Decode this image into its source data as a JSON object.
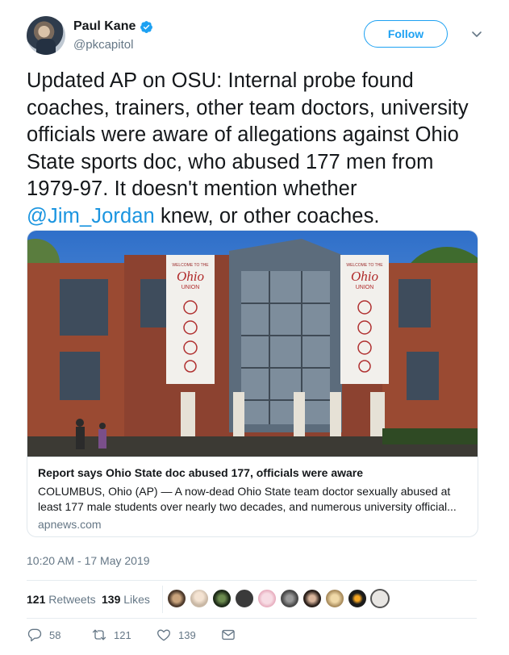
{
  "user": {
    "display_name": "Paul Kane",
    "handle": "@pkcapitol",
    "verified": true
  },
  "header": {
    "follow_label": "Follow"
  },
  "tweet": {
    "text_before": "Updated AP on OSU: Internal probe found coaches, trainers, other team doctors, university officials were aware of allegations against Ohio State sports doc, who abused 177 men from 1979-97. It doesn't mention whether ",
    "mention": "@Jim_Jordan",
    "text_after": " knew, or other coaches."
  },
  "card": {
    "title": "Report says Ohio State doc abused 177, officials were aware",
    "description": "COLUMBUS, Ohio (AP) — A now-dead Ohio State team doctor sexually abused at least 177 male students over nearly two decades, and numerous university official...",
    "domain": "apnews.com",
    "image": {
      "banner_top_text": "WELCOME TO THE",
      "banner_title": "Ohio",
      "banner_subtitle": "UNION"
    }
  },
  "timestamp": "10:20 AM - 17 May 2019",
  "stats": {
    "retweets_count": "121",
    "retweets_label": "Retweets",
    "likes_count": "139",
    "likes_label": "Likes",
    "liker_avatar_count": 9
  },
  "actions": {
    "reply_count": "58",
    "retweet_count": "121",
    "like_count": "139"
  },
  "colors": {
    "accent": "#1da1f2",
    "mention": "#1b95e0",
    "muted": "#657786",
    "text": "#14171a"
  },
  "icons": [
    "verified-badge-icon",
    "chevron-down-icon",
    "reply-icon",
    "retweet-icon",
    "like-icon",
    "direct-message-icon"
  ]
}
